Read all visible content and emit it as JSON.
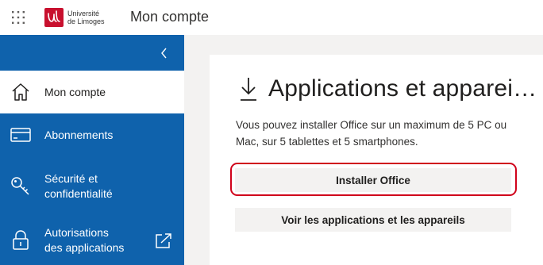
{
  "header": {
    "app_title": "Mon compte",
    "logo_text": "Université\nde Limoges",
    "logo_mark": "ul",
    "waffle_icon": "app-launcher-icon"
  },
  "sidebar": {
    "collapse_icon": "chevron-left-icon",
    "items": [
      {
        "label": "Mon compte",
        "icon": "home-icon",
        "active": true
      },
      {
        "label": "Abonnements",
        "icon": "credit-card-icon",
        "active": false
      },
      {
        "label": "Sécurité et\nconfidentialité",
        "icon": "key-icon",
        "active": false
      },
      {
        "label": "Autorisations\ndes applications",
        "icon": "lock-icon",
        "active": false,
        "external": true
      }
    ]
  },
  "main": {
    "title": "Applications et apparei…",
    "title_icon": "download-icon",
    "description": "Vous pouvez installer Office sur un maximum de 5 PC ou Mac, sur 5 tablettes et 5 smartphones.",
    "install_button": "Installer Office",
    "view_button": "Voir les applications et les appareils"
  },
  "colors": {
    "accent": "#0f62ac",
    "highlight": "#d0021b",
    "brand": "#c8102e",
    "background": "#f3f2f1"
  }
}
